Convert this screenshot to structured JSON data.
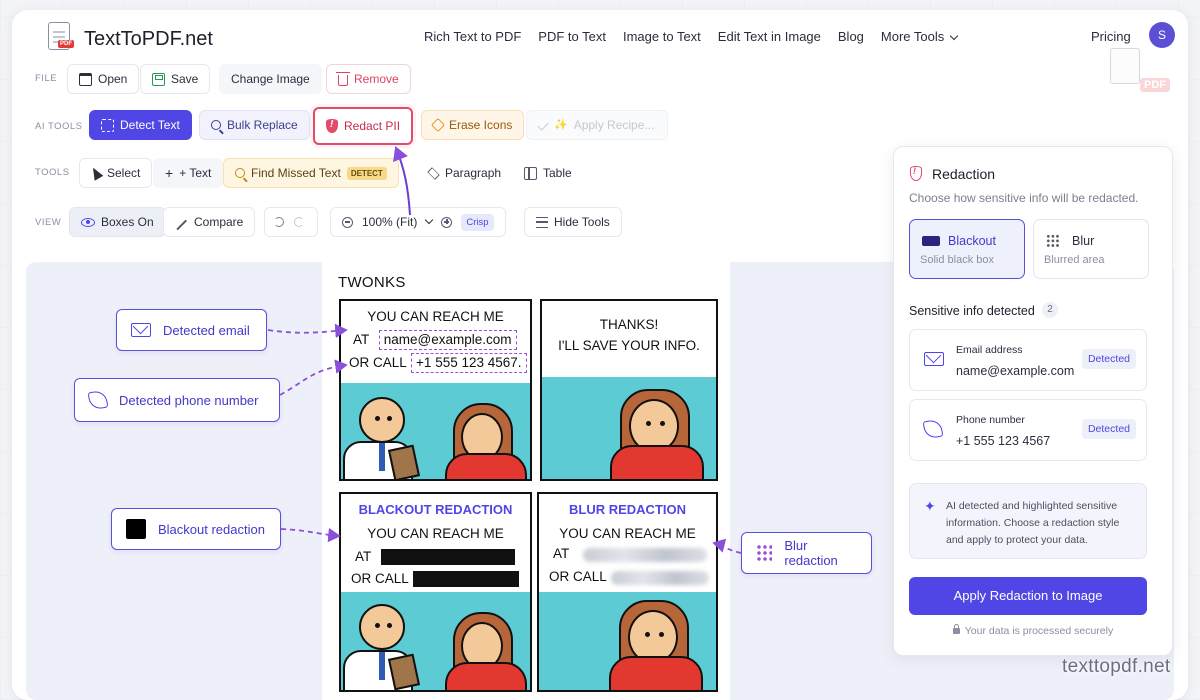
{
  "header": {
    "logo_text": "TextToPDF.net",
    "logo_tag": "PDF",
    "nav": [
      "Rich Text to PDF",
      "PDF to Text",
      "Image to Text",
      "Edit Text in Image",
      "Blog",
      "More Tools"
    ],
    "pricing": "Pricing",
    "avatar_initial": "S",
    "watermark_tag": "PDF"
  },
  "toolbar": {
    "file": {
      "label": "FILE",
      "open": "Open",
      "save": "Save",
      "change_image": "Change Image",
      "remove": "Remove"
    },
    "ai_tools": {
      "label": "AI TOOLS",
      "detect_text": "Detect Text",
      "bulk_replace": "Bulk Replace",
      "redact_pii": "Redact PII",
      "erase_icons": "Erase Icons",
      "apply_recipe": "Apply Recipe..."
    },
    "tools": {
      "label": "TOOLS",
      "select": "Select",
      "add_text": "+ Text",
      "find_missed": "Find Missed Text",
      "detect_badge": "DETECT",
      "paragraph": "Paragraph",
      "table": "Table"
    },
    "view": {
      "label": "VIEW",
      "boxes_on": "Boxes On",
      "compare": "Compare",
      "zoom": "100% (Fit)",
      "crisp": "Crisp",
      "hide_tools": "Hide Tools"
    }
  },
  "comic": {
    "title": "TWONKS",
    "panel1": {
      "line1": "YOU CAN REACH ME",
      "at": "AT",
      "email": "name@example.com",
      "orcall": "OR CALL",
      "phone": "+1 555 123 4567."
    },
    "panel2": {
      "line1": "THANKS!",
      "line2": "I'LL SAVE YOUR INFO."
    },
    "panel3": {
      "title": "BLACKOUT REDACTION",
      "line1": "YOU CAN REACH ME",
      "at": "AT",
      "orcall": "OR CALL"
    },
    "panel4": {
      "title": "BLUR REDACTION",
      "line1": "YOU CAN REACH ME",
      "at": "AT",
      "orcall": "OR CALL"
    }
  },
  "callouts": {
    "email": "Detected email",
    "phone": "Detected phone number",
    "blackout": "Blackout redaction",
    "blur": "Blur redaction"
  },
  "side_panel": {
    "title": "Redaction",
    "subtitle": "Choose how sensitive info will be redacted.",
    "options": [
      {
        "title": "Blackout",
        "desc": "Solid black box"
      },
      {
        "title": "Blur",
        "desc": "Blurred area"
      }
    ],
    "selected_option": "Blackout",
    "detected_title": "Sensitive info detected",
    "detected_count": "2",
    "items": [
      {
        "label": "Email address",
        "value": "name@example.com",
        "status": "Detected",
        "icon": "mail-icon"
      },
      {
        "label": "Phone number",
        "value": "+1 555 123 4567",
        "status": "Detected",
        "icon": "phone-icon"
      }
    ],
    "note": "AI detected and highlighted sensitive information. Choose a redaction style and apply to protect your data.",
    "apply_button": "Apply Redaction to Image",
    "secure_text": "Your data is processed securely"
  },
  "site_watermark": "texttopdf.net",
  "colors": {
    "accent": "#4f46e5",
    "redact": "#e24b6a",
    "teal": "#5ccbd3"
  }
}
